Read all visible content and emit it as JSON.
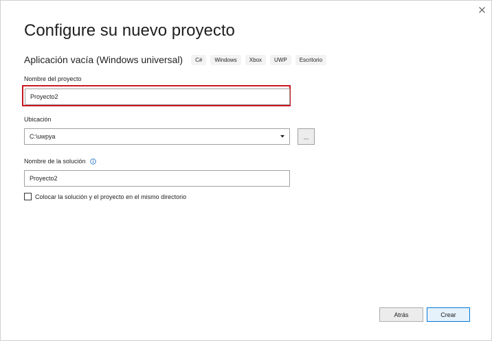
{
  "dialog": {
    "title": "Configure su nuevo proyecto",
    "close_icon": "close-icon"
  },
  "template": {
    "name": "Aplicación vacía (Windows universal)",
    "tags": [
      "C#",
      "Windows",
      "Xbox",
      "UWP",
      "Escritorio"
    ]
  },
  "project_name": {
    "label": "Nombre del proyecto",
    "value": "Proyecto2"
  },
  "location": {
    "label": "Ubicación",
    "value": "C:\\uwpya",
    "browse_label": "..."
  },
  "solution_name": {
    "label": "Nombre de la solución",
    "value": "Proyecto2",
    "info_icon": "info-icon"
  },
  "same_directory": {
    "label": "Colocar la solución y el proyecto en el mismo directorio",
    "checked": false
  },
  "footer": {
    "back_label": "Atrás",
    "create_label": "Crear"
  },
  "colors": {
    "highlight": "#c8161d",
    "accent": "#0078d7",
    "info_icon": "#1e72c8"
  }
}
